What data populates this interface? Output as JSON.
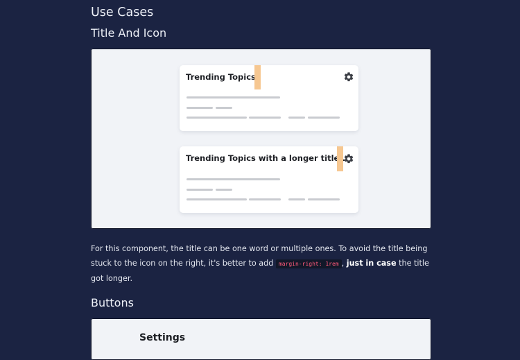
{
  "headings": {
    "use_cases": "Use Cases",
    "title_and_icon": "Title And Icon",
    "buttons": "Buttons"
  },
  "cards": [
    {
      "title": "Trending Topics"
    },
    {
      "title": "Trending Topics with a longer title..."
    }
  ],
  "description": {
    "part1": "For this component, the title can be one word or multiple ones. To avoid the title being stuck to the icon on the right, it's better to add ",
    "code": "margin-right: 1rem",
    "part2": ", ",
    "emphasis": "just in case",
    "part3": " the title got longer."
  },
  "buttons_demo": {
    "title": "Settings"
  },
  "colors": {
    "page_bg": "#1b2342",
    "spacer_highlight": "#f6c791",
    "code_text": "#ff5a7a"
  },
  "icons": [
    "gear-icon"
  ]
}
